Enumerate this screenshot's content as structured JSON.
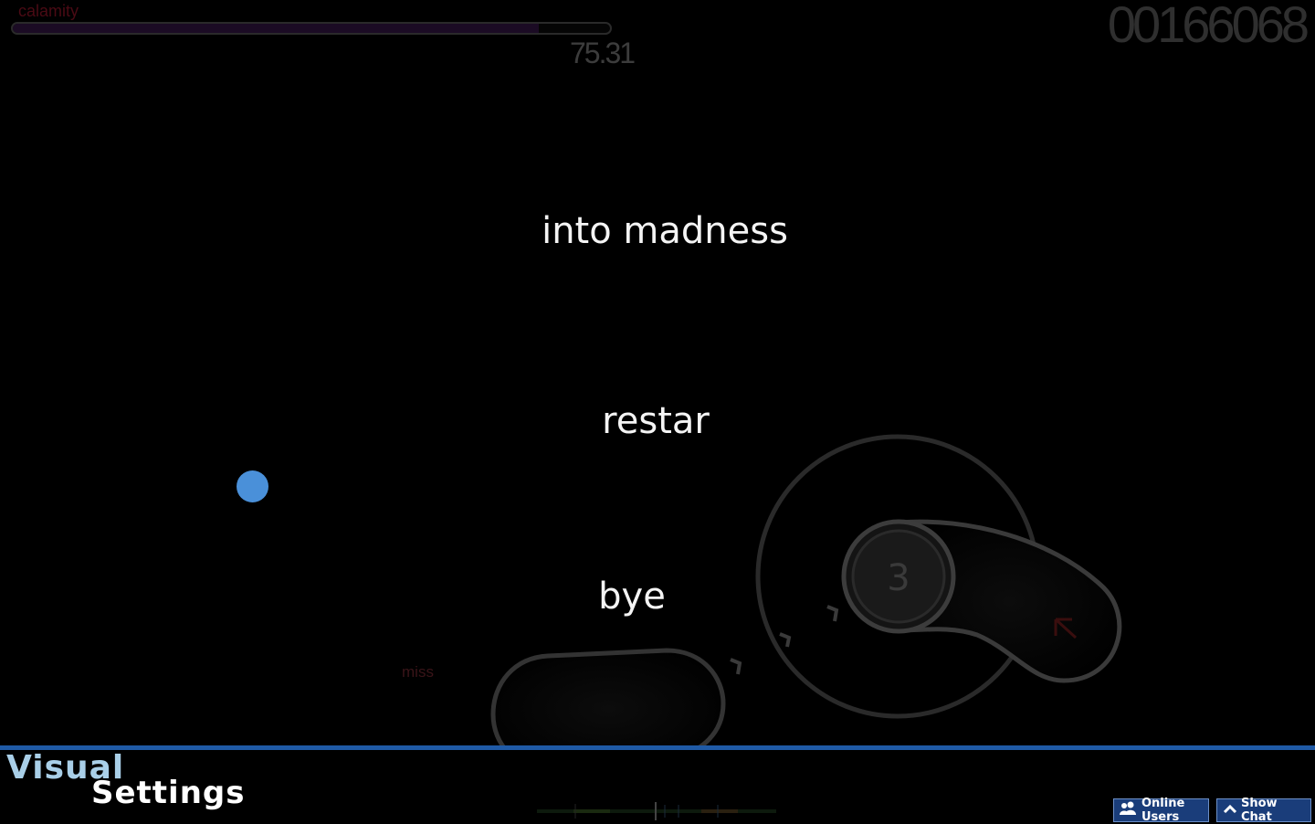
{
  "hud": {
    "song_name": "calamity",
    "progress": 0.88,
    "accuracy": "75.31",
    "score": "00166068"
  },
  "options": {
    "option_1": "into madness",
    "option_2": "restar",
    "option_3": "bye"
  },
  "playfield": {
    "combo_number": "3",
    "judgement": "miss"
  },
  "screen": {
    "title_line_1": "Visual",
    "title_line_2": "Settings"
  },
  "buttons": {
    "online_users": "Online Users",
    "show_chat": "Show Chat"
  },
  "colors": {
    "cursor": "#4a90d9",
    "bottom_line": "#1f5aa6",
    "button_bg": "#1a3d7a"
  },
  "icons": {
    "online_users": "users-icon",
    "show_chat": "chevron-up-icon"
  }
}
